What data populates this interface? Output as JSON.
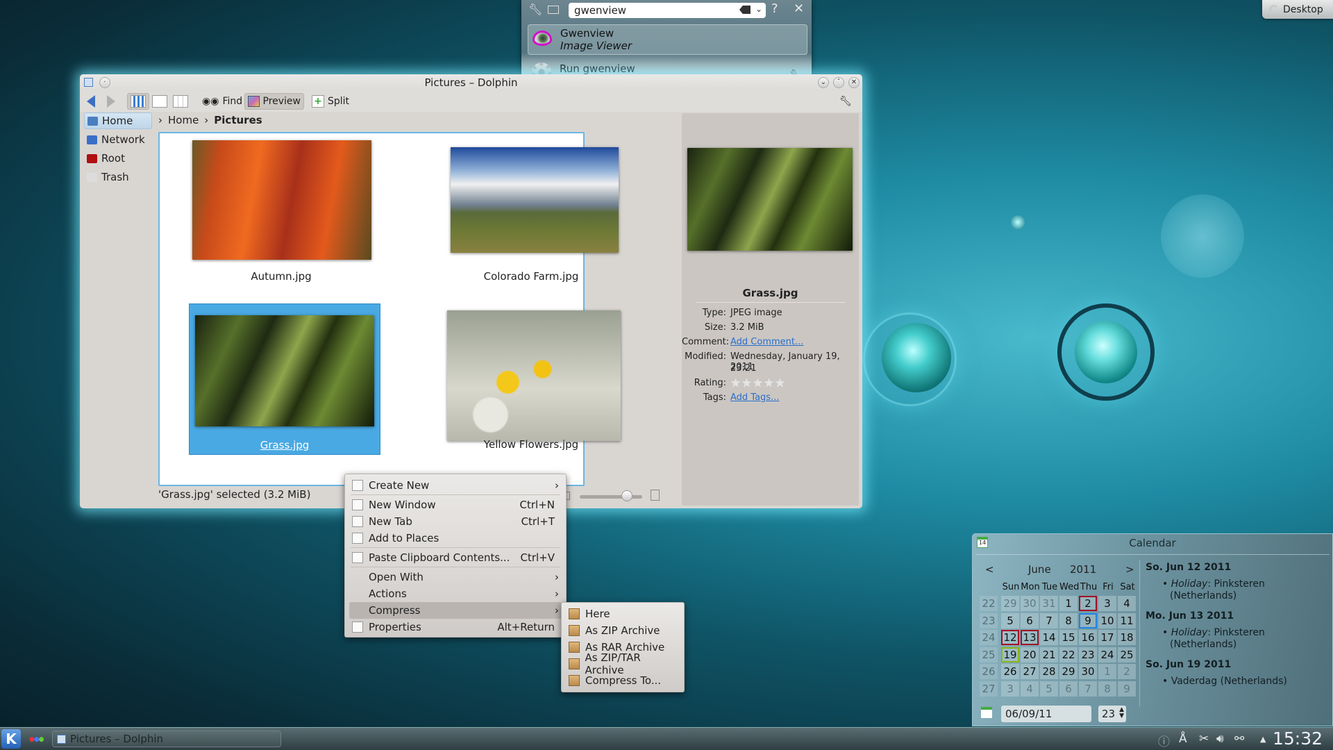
{
  "desktop": {
    "toolbox_label": "Desktop"
  },
  "krunner": {
    "query": "gwenview",
    "results": [
      {
        "title": "Gwenview",
        "subtitle": "Image Viewer",
        "icon": "gwenview-eye-icon"
      },
      {
        "title": "Run gwenview",
        "subtitle": "",
        "icon": "run-gear-icon"
      }
    ],
    "help_label": "?",
    "close_label": "✕"
  },
  "dolphin": {
    "title": "Pictures – Dolphin",
    "toolbar": {
      "find": "Find",
      "preview": "Preview",
      "split": "Split"
    },
    "places": [
      {
        "label": "Home",
        "selected": true,
        "color": "#4a7fbf"
      },
      {
        "label": "Network",
        "selected": false,
        "color": "#3a6fc8"
      },
      {
        "label": "Root",
        "selected": false,
        "color": "#b01010"
      },
      {
        "label": "Trash",
        "selected": false,
        "color": "#dcdcdc"
      }
    ],
    "breadcrumb": [
      "Home",
      "Pictures"
    ],
    "files": [
      {
        "name": "Autumn.jpg",
        "selected": false
      },
      {
        "name": "Colorado Farm.jpg",
        "selected": false
      },
      {
        "name": "Grass.jpg",
        "selected": true
      },
      {
        "name": "Yellow Flowers.jpg",
        "selected": false
      }
    ],
    "status": "'Grass.jpg' selected (3.2 MiB)",
    "zoom_level": 0.75,
    "info": {
      "name": "Grass.jpg",
      "type_label": "Type:",
      "type": "JPEG image",
      "size_label": "Size:",
      "size": "3.2 MiB",
      "comment_label": "Comment:",
      "comment": "Add Comment...",
      "modified_label": "Modified:",
      "modified": "Wednesday, January 19, 2011",
      "modified_time": "23:21",
      "rating_label": "Rating:",
      "rating": 0,
      "rating_max": 5,
      "tags_label": "Tags:",
      "tags": "Add Tags..."
    }
  },
  "context_menu": {
    "items": [
      {
        "label": "Create New",
        "shortcut": "",
        "submenu": true
      },
      {
        "label": "New Window",
        "shortcut": "Ctrl+N",
        "submenu": false
      },
      {
        "label": "New Tab",
        "shortcut": "Ctrl+T",
        "submenu": false
      },
      {
        "label": "Add to Places",
        "shortcut": "",
        "submenu": false
      },
      {
        "label": "Paste Clipboard Contents...",
        "shortcut": "Ctrl+V",
        "submenu": false
      },
      {
        "label": "Open With",
        "shortcut": "",
        "submenu": true
      },
      {
        "label": "Actions",
        "shortcut": "",
        "submenu": true
      },
      {
        "label": "Compress",
        "shortcut": "",
        "submenu": true,
        "highlighted": true
      },
      {
        "label": "Properties",
        "shortcut": "Alt+Return",
        "submenu": false
      }
    ],
    "compress_submenu": [
      "Here",
      "As ZIP Archive",
      "As RAR Archive",
      "As ZIP/TAR Archive",
      "Compress To..."
    ]
  },
  "calendar": {
    "title": "Calendar",
    "month": "June",
    "year": "2011",
    "prev": "<",
    "next": ">",
    "weekdays": [
      "Sun",
      "Mon",
      "Tue",
      "Wed",
      "Thu",
      "Fri",
      "Sat"
    ],
    "weeks": [
      {
        "wk": "22",
        "days": [
          "29",
          "30",
          "31",
          "1",
          "2",
          "3",
          "4"
        ]
      },
      {
        "wk": "23",
        "days": [
          "5",
          "6",
          "7",
          "8",
          "9",
          "10",
          "11"
        ]
      },
      {
        "wk": "24",
        "days": [
          "12",
          "13",
          "14",
          "15",
          "16",
          "17",
          "18"
        ]
      },
      {
        "wk": "25",
        "days": [
          "19",
          "20",
          "21",
          "22",
          "23",
          "24",
          "25"
        ]
      },
      {
        "wk": "26",
        "days": [
          "26",
          "27",
          "28",
          "29",
          "30",
          "1",
          "2"
        ]
      },
      {
        "wk": "27",
        "days": [
          "3",
          "4",
          "5",
          "6",
          "7",
          "8",
          "9"
        ]
      }
    ],
    "date_input": "06/09/11",
    "week_spin": "23",
    "events": [
      {
        "date": "So. Jun 12 2011",
        "lines": [
          [
            "Holiday",
            ": Pinksteren"
          ],
          [
            "",
            "(Netherlands)"
          ]
        ]
      },
      {
        "date": "Mo. Jun 13 2011",
        "lines": [
          [
            "Holiday",
            ": Pinksteren"
          ],
          [
            "",
            "(Netherlands)"
          ]
        ]
      },
      {
        "date": "So. Jun 19 2011",
        "lines": [
          [
            "",
            "Vaderdag (Netherlands)"
          ]
        ]
      }
    ]
  },
  "taskbar": {
    "task_label": "Pictures – Dolphin",
    "clock": "15:32"
  }
}
